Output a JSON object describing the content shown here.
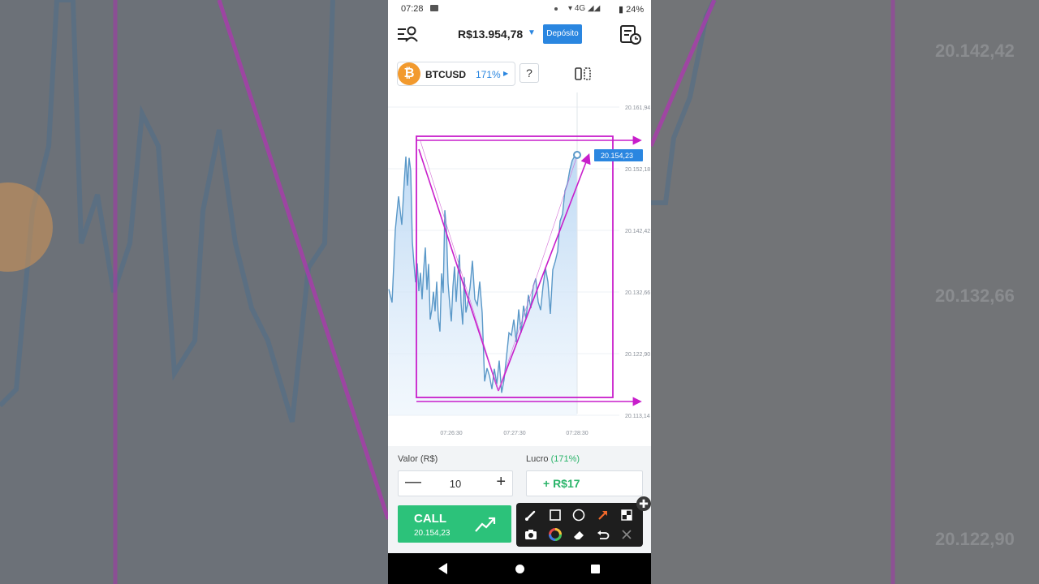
{
  "status_bar": {
    "time": "07:28",
    "network": "4G",
    "battery": "24%"
  },
  "header": {
    "balance": "R$13.954,78",
    "deposit_label": "Depósito"
  },
  "asset": {
    "name": "BTCUSD",
    "payout": "171%",
    "help": "?"
  },
  "chart_data": {
    "type": "area",
    "y_ticks": [
      "20.161,94",
      "20.152,18",
      "20.142,42",
      "20.132,66",
      "20.122,90",
      "20.113,14"
    ],
    "x_ticks": [
      "07:26:30",
      "07:27:30",
      "07:28:30"
    ],
    "current_price": "20.154,23",
    "ylim": [
      20113.14,
      20161.94
    ],
    "x": [
      0,
      4,
      8,
      12,
      16,
      19,
      21,
      23,
      25,
      27,
      29,
      31,
      33,
      35,
      37,
      39,
      41,
      43,
      45,
      47,
      49,
      51,
      53,
      55,
      57,
      59,
      61,
      63,
      65,
      67,
      69,
      71,
      73,
      75,
      77,
      79,
      81,
      83,
      85,
      87,
      89,
      91,
      93,
      95,
      97,
      100,
      103,
      106,
      109,
      112,
      115,
      118,
      121,
      124,
      127,
      130,
      133,
      136,
      139,
      142,
      145,
      148,
      151,
      154,
      157,
      160,
      163,
      166,
      169,
      172,
      175,
      178,
      181,
      184,
      187,
      190,
      193,
      196,
      199,
      202,
      205,
      208,
      211,
      214,
      217,
      220,
      223,
      226,
      229,
      232
    ],
    "values": [
      20133.1,
      20131.0,
      20142.5,
      20147.8,
      20143.3,
      20150.1,
      20154.1,
      20149.5,
      20153.9,
      20151.8,
      20140.6,
      20137.1,
      20134.2,
      20137.2,
      20132.8,
      20135.7,
      20131.5,
      20136.3,
      20139.7,
      20133.0,
      20137.1,
      20128.3,
      20129.9,
      20132.7,
      20129.6,
      20134.3,
      20128.5,
      20126.4,
      20135.6,
      20132.5,
      20145.6,
      20142.5,
      20134.1,
      20130.8,
      20128.0,
      20133.5,
      20136.7,
      20131.1,
      20135.2,
      20138.6,
      20131.0,
      20127.5,
      20135.0,
      20129.4,
      20130.7,
      20133.3,
      20137.6,
      20131.5,
      20130.6,
      20134.3,
      20129.4,
      20118.5,
      20120.6,
      20119.4,
      20117.3,
      20120.5,
      20118.1,
      20121.8,
      20116.7,
      20118.8,
      20122.4,
      20126.2,
      20125.8,
      20128.3,
      20124.7,
      20129.9,
      20126.2,
      20130.5,
      20128.4,
      20132.2,
      20130.1,
      20133.6,
      20134.8,
      20131.1,
      20129.8,
      20133.6,
      20136.4,
      20134.3,
      20129.2,
      20136.2,
      20137.5,
      20139.1,
      20143.9,
      20145.0,
      20148.7,
      20149.8,
      20152.0,
      20153.5,
      20154.2,
      20154.2
    ]
  },
  "trade": {
    "valor_label": "Valor (R$)",
    "amount": "10",
    "lucro_label": "Lucro",
    "lucro_pct": "(171%)",
    "profit": "+ R$17",
    "call_label": "CALL",
    "call_price": "20.154,23"
  },
  "background": {
    "labels": [
      "20.142,42",
      "20.132,66",
      "20.122,90"
    ]
  },
  "colors": {
    "accent": "#2a86e0",
    "call": "#2cc27a",
    "annotation": "#c81ecb",
    "line": "#5a98c8"
  }
}
